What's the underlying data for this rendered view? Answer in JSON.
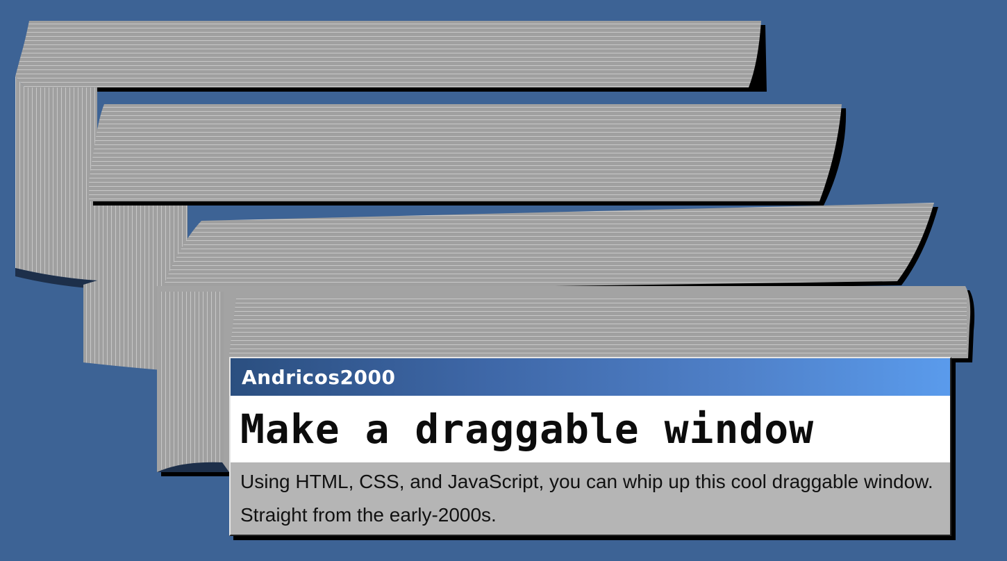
{
  "window": {
    "title": "Andricos2000",
    "heading": "Make a draggable window",
    "description": "Using HTML, CSS, and JavaScript, you can whip up this cool draggable window. Straight from the early-2000s."
  },
  "colors": {
    "desktop": "#3d6395",
    "window_face": "#b5b5b5",
    "trail_gray": "#a1a1a1",
    "title_gradient_start": "#2b4f80",
    "title_gradient_end": "#5a9bec"
  }
}
